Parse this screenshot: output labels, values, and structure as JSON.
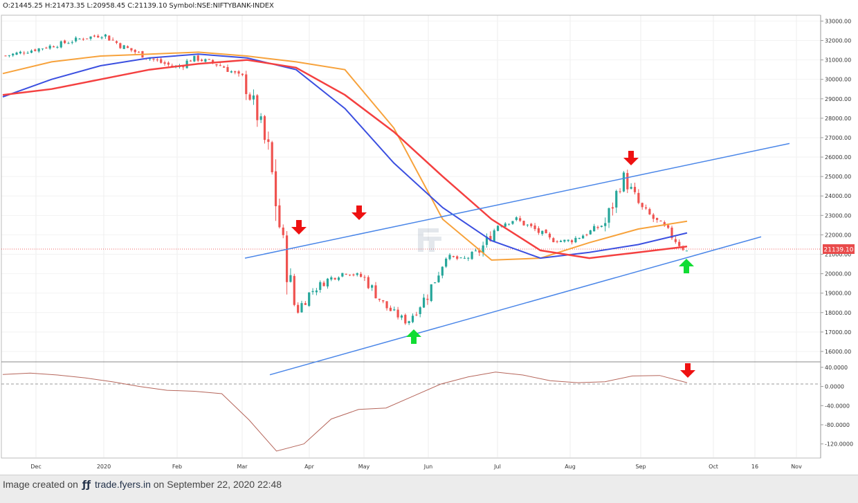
{
  "header": {
    "ohlc_text": "O:21445.25 H:21473.35 L:20958.45 C:21139.10 Symbol:NSE:NIFTYBANK-INDEX"
  },
  "footer": {
    "prefix": "Image created on",
    "logo": "ƒƒ",
    "brand": "trade.fyers.in",
    "suffix": "on September 22, 2020 22:48"
  },
  "colors": {
    "up": "#26a69a",
    "down": "#ef5350",
    "ma_orange": "#f7a23b",
    "ma_blue": "#3b4fe0",
    "ma_red": "#f44040",
    "channel": "#4a86e8",
    "osc": "#b5655a",
    "arrow_down": "#ee1111",
    "arrow_up": "#11dd33"
  },
  "chart_data": [
    {
      "type": "candlestick",
      "symbol": "NSE:NIFTYBANK-INDEX",
      "last_price_label": "21139.10",
      "ylim": [
        15500,
        33300
      ],
      "y_ticks": [
        "33000.00",
        "32000.00",
        "31000.00",
        "30000.00",
        "29000.00",
        "28000.00",
        "27000.00",
        "26000.00",
        "25000.00",
        "24000.00",
        "23000.00",
        "22000.00",
        "21000.00",
        "20000.00",
        "19000.00",
        "18000.00",
        "17000.00",
        "16000.00"
      ],
      "x_labels": [
        "Dec",
        "2020",
        "Feb",
        "Mar",
        "Apr",
        "May",
        "Jun",
        "Jul",
        "Aug",
        "Sep",
        "Oct",
        "16",
        "Nov"
      ],
      "close_path": [
        [
          "Dec",
          31200
        ],
        [
          "Dec",
          31800
        ],
        [
          "Dec",
          32100
        ],
        [
          "2020",
          32300
        ],
        [
          "2020",
          31700
        ],
        [
          "2020",
          31300
        ],
        [
          "2020",
          30900
        ],
        [
          "Feb",
          30600
        ],
        [
          "Feb",
          31100
        ],
        [
          "Feb",
          30900
        ],
        [
          "Feb",
          30600
        ],
        [
          "Mar",
          30000
        ],
        [
          "Mar",
          28500
        ],
        [
          "Mar",
          26000
        ],
        [
          "Mar",
          21500
        ],
        [
          "Mar",
          18000
        ],
        [
          "Apr",
          19000
        ],
        [
          "Apr",
          19700
        ],
        [
          "Apr",
          20100
        ],
        [
          "May",
          19800
        ],
        [
          "May",
          18300
        ],
        [
          "May",
          17500
        ],
        [
          "Jun",
          19000
        ],
        [
          "Jun",
          20900
        ],
        [
          "Jun",
          20700
        ],
        [
          "Jun",
          21200
        ],
        [
          "Jul",
          22500
        ],
        [
          "Jul",
          22800
        ],
        [
          "Jul",
          22300
        ],
        [
          "Jul",
          21700
        ],
        [
          "Aug",
          21700
        ],
        [
          "Aug",
          22100
        ],
        [
          "Aug",
          22600
        ],
        [
          "Aug",
          25000
        ],
        [
          "Sep",
          23400
        ],
        [
          "Sep",
          22300
        ],
        [
          "Sep",
          21139
        ]
      ],
      "moving_averages": [
        {
          "color": "orange",
          "values": [
            30300,
            30900,
            31200,
            31300,
            31400,
            31200,
            30900,
            30500,
            27500,
            22800,
            20700,
            20800,
            21600,
            22300,
            22700
          ]
        },
        {
          "color": "blue",
          "values": [
            29100,
            30000,
            30700,
            31100,
            31300,
            31100,
            30500,
            28500,
            25700,
            23400,
            21700,
            20800,
            21100,
            21500,
            22100
          ]
        },
        {
          "color": "red",
          "values": [
            29200,
            29500,
            30000,
            30500,
            30800,
            31000,
            30600,
            29200,
            27300,
            25000,
            22800,
            21200,
            20800,
            21100,
            21400
          ]
        }
      ],
      "channel_lines": [
        {
          "name": "upper",
          "from": [
            "Mar",
            20800
          ],
          "to": [
            "Nov",
            26700
          ]
        },
        {
          "name": "lower",
          "from": [
            "Mar",
            14800
          ],
          "to": [
            "Oct",
            21900
          ]
        }
      ],
      "annotations": [
        {
          "type": "arrow-down",
          "near": [
            "Mar",
            22000
          ]
        },
        {
          "type": "arrow-down",
          "near": [
            "Apr",
            22200
          ]
        },
        {
          "type": "arrow-down",
          "near": [
            "Aug",
            25500
          ]
        },
        {
          "type": "arrow-up",
          "near": [
            "May",
            16800
          ]
        },
        {
          "type": "arrow-up",
          "near": [
            "Sep",
            20000
          ]
        }
      ]
    },
    {
      "type": "line",
      "name": "oscillator",
      "ylim": [
        -148,
        50
      ],
      "y_ticks": [
        "40.0000",
        "0.0000",
        "-40.0000",
        "-80.0000",
        "-120.0000"
      ],
      "values": [
        25,
        28,
        24,
        18,
        10,
        0,
        -8,
        -10,
        -15,
        -70,
        -135,
        -120,
        -68,
        -48,
        -45,
        -20,
        5,
        20,
        30,
        24,
        12,
        8,
        10,
        22,
        23,
        8
      ]
    }
  ]
}
